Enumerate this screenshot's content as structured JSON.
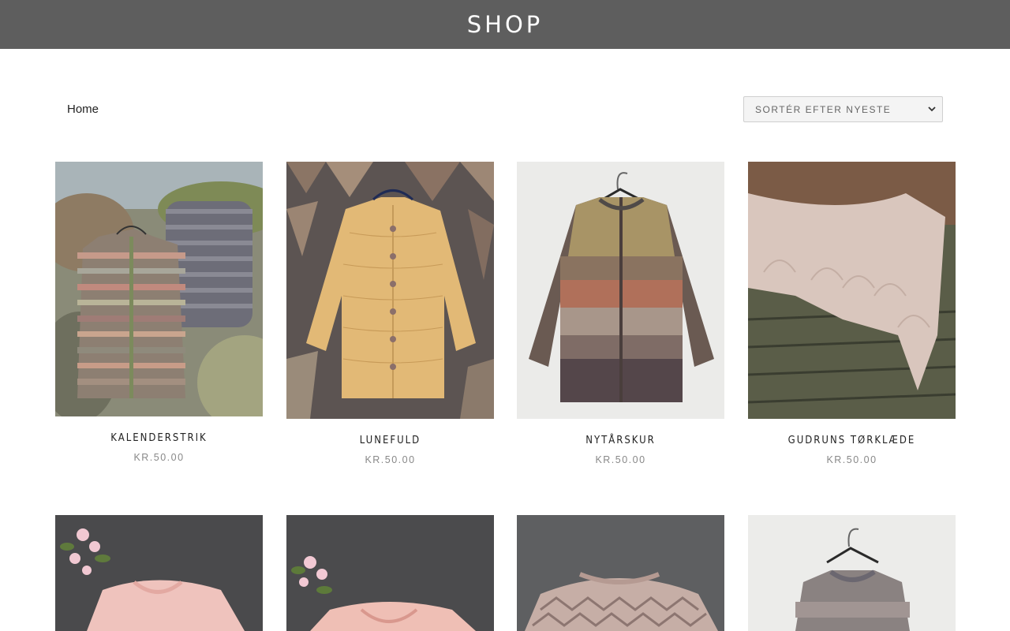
{
  "header": {
    "title": "SHOP"
  },
  "breadcrumb": {
    "home": "Home"
  },
  "sort": {
    "selected": "SORTÉR EFTER NYESTE"
  },
  "products": [
    {
      "name": "KALENDERSTRIK",
      "price": "KR.50.00"
    },
    {
      "name": "LUNEFULD",
      "price": "KR.50.00"
    },
    {
      "name": "NYTÅRSKUR",
      "price": "KR.50.00"
    },
    {
      "name": "GUDRUNS TØRKLÆDE",
      "price": "KR.50.00"
    },
    {
      "name": "",
      "price": ""
    },
    {
      "name": "",
      "price": ""
    },
    {
      "name": "",
      "price": ""
    },
    {
      "name": "",
      "price": ""
    }
  ],
  "colors": {
    "header_bg": "#5e5e5e",
    "text": "#222222",
    "price": "#888888"
  }
}
